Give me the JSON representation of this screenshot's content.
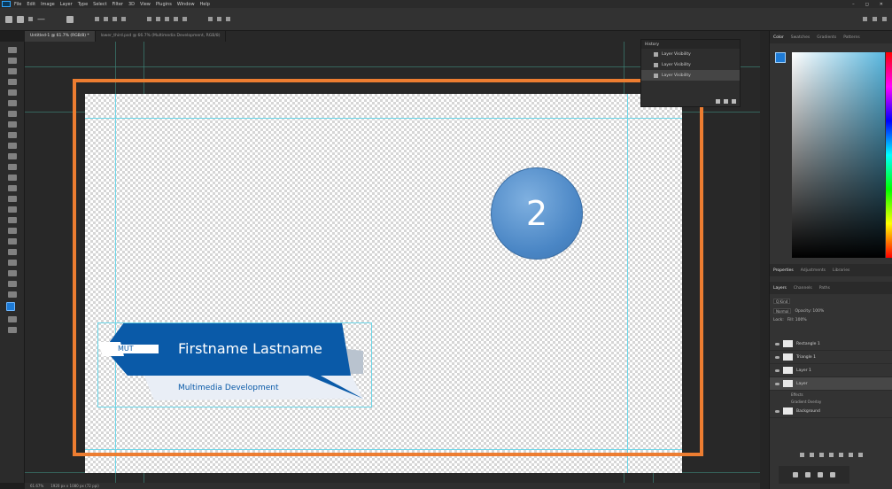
{
  "app": {
    "menu": [
      "File",
      "Edit",
      "Image",
      "Layer",
      "Type",
      "Select",
      "Filter",
      "3D",
      "View",
      "Plugins",
      "Window",
      "Help"
    ],
    "window_controls": [
      "–",
      "◻",
      "✕"
    ]
  },
  "options_bar": {
    "mode_field": "—"
  },
  "tabs": [
    {
      "label": "Untitled-1 @ 61.7% (RGB/8) *",
      "active": true
    },
    {
      "label": "lower_third.psd @ 66.7% (Multimedia Development, RGB/8)",
      "active": false
    }
  ],
  "canvas": {
    "lower_third": {
      "name": "Firstname Lastname",
      "tag": "MUT",
      "subtitle": "Multimedia Development",
      "colors": {
        "band": "#0a5aa8",
        "shadow": "#b9c3cf",
        "subtitle_band": "#e9eef6"
      }
    },
    "callout": {
      "label": "2",
      "frame_color": "#ed7d31",
      "badge_color": "#5b9bd5"
    }
  },
  "history": {
    "title": "History",
    "items": [
      "Layer Visibility",
      "Layer Visibility",
      "Layer Visibility"
    ],
    "selected_index": 2
  },
  "color_panel": {
    "tabs": [
      "Color",
      "Swatches",
      "Gradients",
      "Patterns"
    ],
    "foreground": "#1e7bd6"
  },
  "properties_tabs": [
    "Properties",
    "Adjustments",
    "Libraries"
  ],
  "layers_panel": {
    "tabs": [
      "Layers",
      "Channels",
      "Paths"
    ],
    "filter": "Q Kind",
    "blend_mode": "Normal",
    "opacity_label": "Opacity: 100%",
    "lock_label": "Lock:",
    "fill_label": "Fill: 100%",
    "layers": [
      {
        "name": "Rectangle 1",
        "selected": false
      },
      {
        "name": "Triangle 1",
        "selected": false
      },
      {
        "name": "Layer 1",
        "selected": false
      },
      {
        "name": "Layer",
        "selected": true,
        "effects": [
          "Effects",
          "Gradient Overlay"
        ]
      },
      {
        "name": "Background",
        "selected": false
      }
    ]
  },
  "status": {
    "zoom": "61.67%",
    "info": "1920 px x 1080 px (72 ppi)"
  }
}
